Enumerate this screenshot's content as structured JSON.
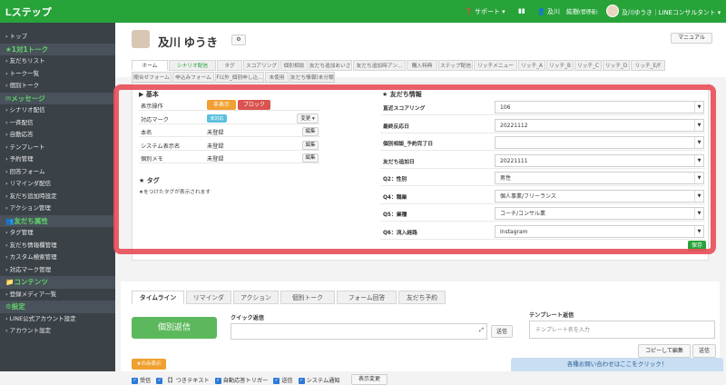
{
  "topbar": {
    "logo": "Lステップ",
    "support": "サポート",
    "user": "及川　紘樹",
    "user_role": "(管理者)",
    "account": "及川ゆうき｜LINEコンサルタント"
  },
  "sidebar": [
    {
      "type": "item",
      "label": "トップ"
    },
    {
      "type": "head",
      "label": "1対1トーク"
    },
    {
      "type": "item",
      "label": "友だちリスト"
    },
    {
      "type": "item",
      "label": "トーク一覧"
    },
    {
      "type": "item",
      "label": "個別トーク"
    },
    {
      "type": "head",
      "label": "メッセージ"
    },
    {
      "type": "item",
      "label": "シナリオ配信"
    },
    {
      "type": "item",
      "label": "一斉配信"
    },
    {
      "type": "item",
      "label": "自動応答"
    },
    {
      "type": "item",
      "label": "テンプレート"
    },
    {
      "type": "item",
      "label": "予約管理"
    },
    {
      "type": "item",
      "label": "回答フォーム"
    },
    {
      "type": "item",
      "label": "リマインダ配信"
    },
    {
      "type": "item",
      "label": "友だち追加時設定"
    },
    {
      "type": "item",
      "label": "アクション管理"
    },
    {
      "type": "head",
      "label": "友だち属性"
    },
    {
      "type": "item",
      "label": "タグ管理"
    },
    {
      "type": "item",
      "label": "友だち情報欄管理"
    },
    {
      "type": "item",
      "label": "カスタム検索管理"
    },
    {
      "type": "item",
      "label": "対応マーク管理"
    },
    {
      "type": "head",
      "label": "コンテンツ"
    },
    {
      "type": "item",
      "label": "登録メディア一覧"
    },
    {
      "type": "head",
      "label": "設定"
    },
    {
      "type": "item",
      "label": "LINE公式アカウント設定"
    },
    {
      "type": "item",
      "label": "アカウント設定"
    }
  ],
  "profile": {
    "name": "及川 ゆうき",
    "manual": "マニュアル"
  },
  "tabs_row1": [
    "ホーム",
    "シナリオ配信",
    "タグ",
    "スコアリング",
    "個別相談",
    "友だち追加あいさ...",
    "友だち追加時アン...",
    "購入特典",
    "ステップ配信",
    "リッチメニュー",
    "リッチ_A",
    "リッチ_B",
    "リッチ_C",
    "リッチ_D",
    "リッチ_E/F"
  ],
  "tabs_row2": [
    "閲合せフォーム",
    "申込みフォーム",
    "F以外_個別申し込...",
    "未使用",
    "友だち情報(未分類)"
  ],
  "basic": {
    "title": "▶ 基本",
    "rows": [
      {
        "label": "表示操作",
        "btn_hide": "非表示",
        "btn_block": "ブロック"
      },
      {
        "label": "対応マーク",
        "badge": "未対応",
        "change": "変更 ▾"
      },
      {
        "label": "本名",
        "value": "未登録",
        "edit": "編集"
      },
      {
        "label": "システム表示名",
        "value": "未登録",
        "edit": "編集"
      },
      {
        "label": "個別メモ",
        "value": "未登録",
        "edit": "編集"
      }
    ]
  },
  "tags": {
    "title": "★ タグ",
    "note": "★をつけたタグが表示されます"
  },
  "friend_info": {
    "title": "★ 友だち情報",
    "fields": [
      {
        "label": "直近スコアリング",
        "value": "106"
      },
      {
        "label": "最終反応日",
        "value": "20221112"
      },
      {
        "label": "個別相談_予約完了日",
        "value": ""
      },
      {
        "label": "友だち追加日",
        "value": "20221111"
      },
      {
        "label": "Q2：性別",
        "value": "男性"
      },
      {
        "label": "Q4：職業",
        "value": "個人事業/フリーランス"
      },
      {
        "label": "Q5：業種",
        "value": "コーチ/コンサル業"
      },
      {
        "label": "Q6：流入経路",
        "value": "Instagram"
      }
    ],
    "save": "保存"
  },
  "bottom_tabs": [
    "タイムライン",
    "リマインダ",
    "アクション",
    "個別トーク",
    "フォーム回答",
    "友だち予約"
  ],
  "bottom": {
    "reply_btn": "個別返信",
    "quick_label": "クイック返信",
    "send": "送信",
    "template_label": "テンプレート返信",
    "template_placeholder": "テンプレート名を入力",
    "copy_edit": "コピーして編集",
    "send2": "送信",
    "star_only": "★のみ表示",
    "filters": [
      "受信",
      "【】つきテキスト",
      "自動応答トリガー",
      "送信",
      "システム通知"
    ],
    "display_change": "表示変更",
    "inquiry": "各種お問い合わせはここをクリック！"
  },
  "colors": {
    "green": "#27a33a",
    "sidebar": "#3a4147",
    "highlight": "#e8505b"
  }
}
